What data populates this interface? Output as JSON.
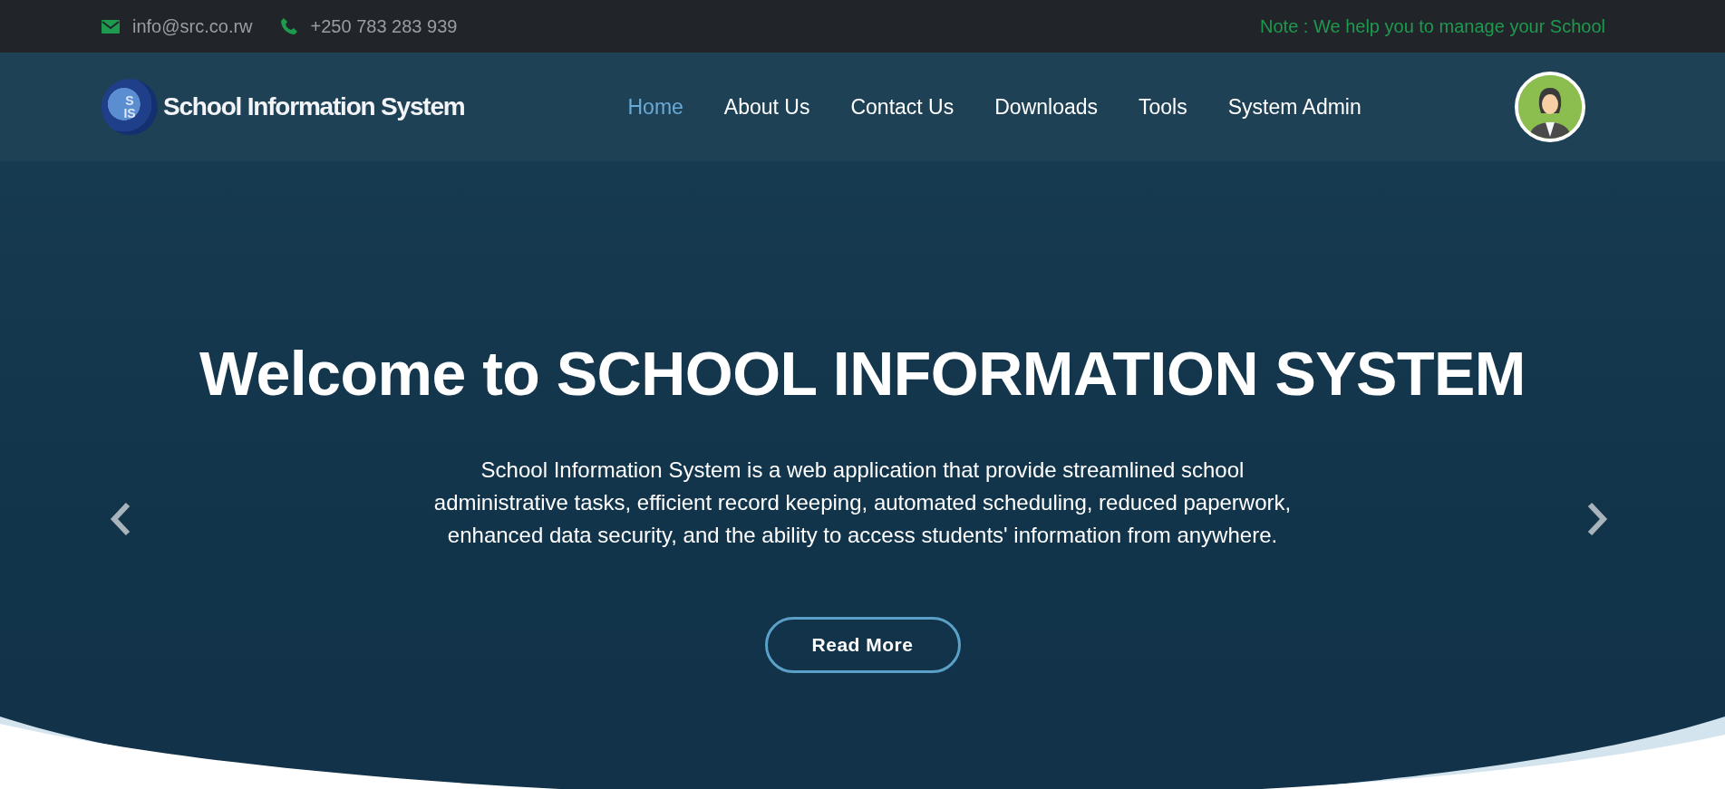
{
  "top_bar": {
    "email": "info@src.co.rw",
    "phone": "+250 783 283 939",
    "note": "Note : We help you to manage your School"
  },
  "nav": {
    "logo_text": "School Information System",
    "logo_initials": [
      "S",
      "IS"
    ],
    "items": [
      {
        "label": "Home",
        "selected": true
      },
      {
        "label": "About Us",
        "selected": false
      },
      {
        "label": "Contact Us",
        "selected": false
      },
      {
        "label": "Downloads",
        "selected": false
      },
      {
        "label": "Tools",
        "selected": false
      },
      {
        "label": "System Admin",
        "selected": false
      }
    ]
  },
  "hero": {
    "heading_start": "Welcome to",
    "heading_end": "SCHOOL INFORMATION SYSTEM",
    "text": "School Information System is a web application that provide streamlined school administrative tasks, efficient record keeping, automated scheduling, reduced paperwork, enhanced data security, and the ability to access students' information from anywhere.",
    "button": "Read More"
  }
}
